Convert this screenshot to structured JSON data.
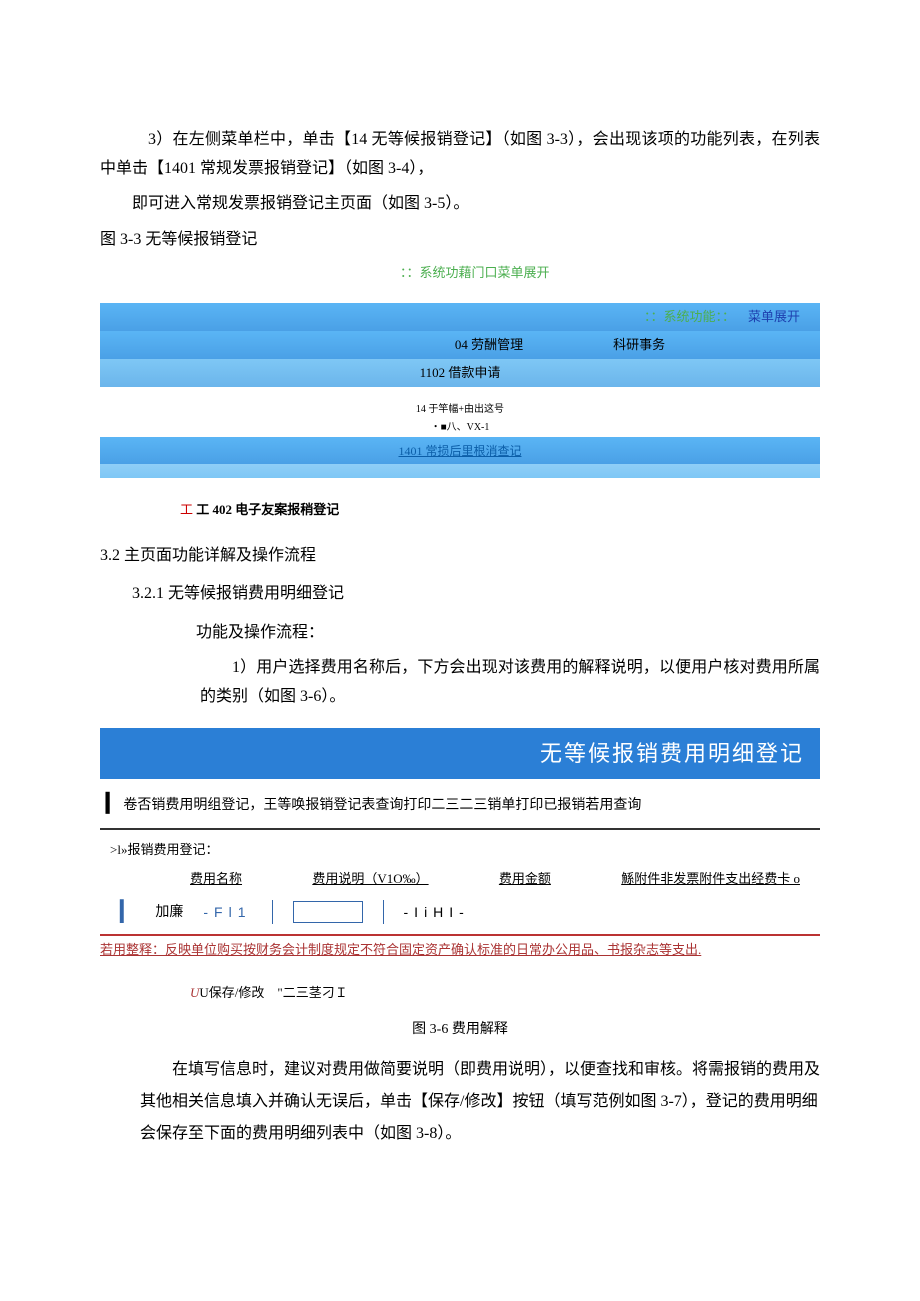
{
  "p1": "3）在左侧菜单栏中，单击【14 无等候报销登记】（如图 3-3），会出现该项的功能列表，在列表中单击【1401 常规发票报销登记】（如图 3-4），",
  "p2": "即可进入常规发票报销登记主页面（如图 3-5）。",
  "caption33": "图 3-3 无等候报销登记",
  "ss1": {
    "top": "：：系统功藉门口菜单展开",
    "top_r": "：：系统功能：：",
    "top_r2": "菜单展开",
    "mid1": "04 劳酬管理",
    "mid2": "科研事务",
    "cent": "1102 借款申请",
    "tiny1": "14 于竿幅+由出这号",
    "tiny2": "・■八、VX-1",
    "link": "1401 常损后里根消查记",
    "bottom": "工 402 电子友案报稍登记"
  },
  "s32": "3.2 主页面功能详解及操作流程",
  "s321": "3.2.1 无等候报销费用明细登记",
  "s321a": "功能及操作流程：",
  "s321b": "1）用户选择费用名称后，下方会出现对该费用的解释说明，以便用户核对费用所属的类别（如图 3-6）。",
  "panel": {
    "head": "无等候报销费用明细登记",
    "tabs": "卷否销费用明组登记，王等唤报销登记表查询打印二三二三销单打印已报销若用查询",
    "form_label": ">l»报销费用登记：",
    "th1": "费用名称",
    "th2": "费用说明（V1O‰）",
    "th3": "费用金额",
    "th4": "鯀附件非发票附件支出经费卡 o",
    "f1": "加廉",
    "f2": "-Fl1",
    "f3": "-IiHI-",
    "explain": "若用整释：反映单位购买按财务会计制度规定不符合固定资产确认标准的日常办公用品、书报杂志等支出.",
    "save": "U保存/修改　\"二三茎刁Ｉ"
  },
  "figcap": "图 3-6 费用解释",
  "body": "在填写信息时，建议对费用做简要说明（即费用说明），以便查找和审核。将需报销的费用及其他相关信息填入并确认无误后，单击【保存/修改】按钮（填写范例如图 3-7），登记的费用明细会保存至下面的费用明细列表中（如图 3-8）。"
}
